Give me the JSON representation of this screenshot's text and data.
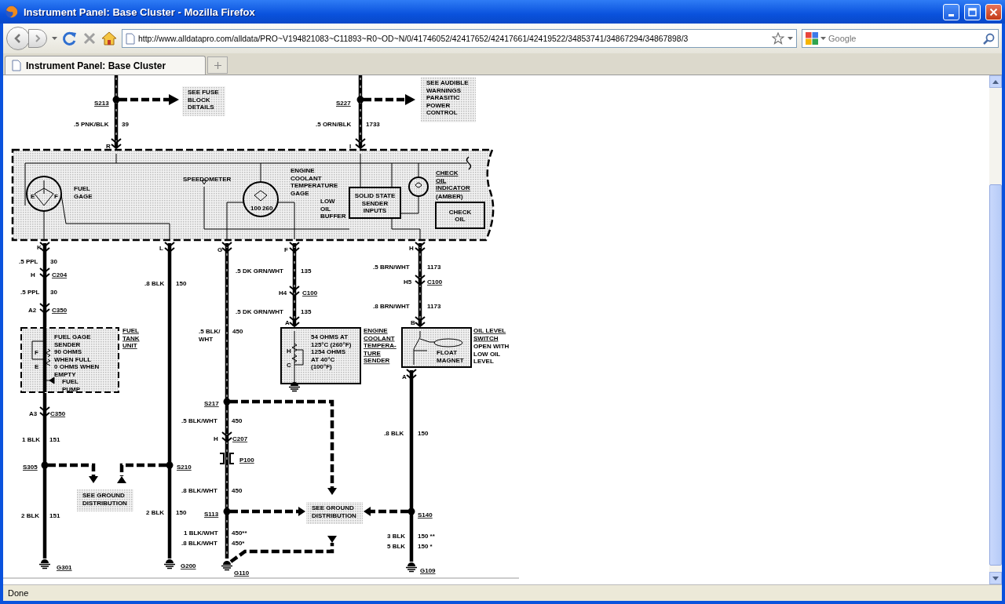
{
  "window": {
    "title": "Instrument Panel: Base Cluster - Mozilla Firefox"
  },
  "toolbar": {
    "url": "http://www.alldatapro.com/alldata/PRO~V194821083~C11893~R0~OD~N/0/41746052/42417652/42417661/42419522/34853741/34867294/34867898/3",
    "search": {
      "placeholder": "Google"
    }
  },
  "tabs": [
    {
      "label": "Instrument Panel: Base Cluster",
      "selected": true
    }
  ],
  "diagram": {
    "labels": [
      {
        "kind": "ref",
        "text": "S213"
      },
      {
        "kind": "callout",
        "lines": [
          "SEE FUSE",
          "BLOCK",
          "DETAILS"
        ]
      },
      {
        "kind": "ref",
        "text": "S227"
      },
      {
        "kind": "callout",
        "lines": [
          "SEE AUDIBLE",
          "WARNINGS",
          "PARASITIC",
          "POWER",
          "CONTROL"
        ]
      },
      {
        "kind": "wire",
        "text": ".5 PNK/BLK"
      },
      {
        "kind": "wire",
        "text": "39"
      },
      {
        "kind": "wire",
        "text": ".5 ORN/BLK"
      },
      {
        "kind": "wire",
        "text": "1733"
      },
      {
        "kind": "pin",
        "text": "R"
      },
      {
        "kind": "pin",
        "text": "I"
      },
      {
        "kind": "note",
        "lines": [
          "FUEL",
          "GAGE"
        ]
      },
      {
        "kind": "note",
        "text": "SPEEDOMETER"
      },
      {
        "kind": "note",
        "lines": [
          "ENGINE",
          "COOLANT",
          "TEMPERATURE",
          "GAGE"
        ]
      },
      {
        "kind": "note",
        "lines": [
          "LOW",
          "OIL",
          "BUFFER"
        ]
      },
      {
        "kind": "boxed",
        "lines": [
          "SOLID STATE",
          "SENDER",
          "INPUTS"
        ]
      },
      {
        "kind": "ref",
        "lines": [
          "CHECK",
          "OIL",
          "INDICATOR"
        ]
      },
      {
        "kind": "note",
        "text": "E"
      },
      {
        "kind": "note",
        "text": "F"
      },
      {
        "kind": "note",
        "text": "100"
      },
      {
        "kind": "note",
        "text": "260"
      },
      {
        "kind": "note",
        "text": "(AMBER)"
      },
      {
        "kind": "boxed",
        "lines": [
          "CHECK",
          "OIL"
        ]
      },
      {
        "kind": "pin",
        "text": "K"
      },
      {
        "kind": "pin",
        "text": "L"
      },
      {
        "kind": "pin",
        "text": "G"
      },
      {
        "kind": "pin",
        "text": "F"
      },
      {
        "kind": "pin",
        "text": "H"
      },
      {
        "kind": "wire",
        "text": ".5 PPL"
      },
      {
        "kind": "wire",
        "text": "30"
      },
      {
        "kind": "wire",
        "text": ".5 DK GRN/WHT"
      },
      {
        "kind": "wire",
        "text": "135"
      },
      {
        "kind": "wire",
        "text": ".5 BRN/WHT"
      },
      {
        "kind": "wire",
        "text": "1173"
      },
      {
        "kind": "pin",
        "text": "H"
      },
      {
        "kind": "ref",
        "text": "C204"
      },
      {
        "kind": "wire",
        "text": ".8 BLK"
      },
      {
        "kind": "wire",
        "text": "150"
      },
      {
        "kind": "pin",
        "text": "H5"
      },
      {
        "kind": "ref",
        "text": "C100"
      },
      {
        "kind": "wire",
        "text": ".5 PPL"
      },
      {
        "kind": "wire",
        "text": "30"
      },
      {
        "kind": "pin",
        "text": "H4"
      },
      {
        "kind": "ref",
        "text": "C100"
      },
      {
        "kind": "wire",
        "text": ".8 BRN/WHT"
      },
      {
        "kind": "wire",
        "text": "1173"
      },
      {
        "kind": "pin",
        "text": "A2"
      },
      {
        "kind": "ref",
        "text": "C350"
      },
      {
        "kind": "wire",
        "text": ".5 DK GRN/WHT"
      },
      {
        "kind": "wire",
        "text": "135"
      },
      {
        "kind": "pin",
        "text": "A"
      },
      {
        "kind": "pin",
        "text": "B"
      },
      {
        "kind": "wire",
        "lines": [
          ".5 BLK/",
          "WHT"
        ]
      },
      {
        "kind": "wire",
        "text": "450"
      },
      {
        "kind": "note",
        "text": "F"
      },
      {
        "kind": "note",
        "text": "E"
      },
      {
        "kind": "note",
        "lines": [
          "FUEL GAGE",
          "SENDER",
          "90 OHMS",
          "WHEN FULL",
          "0 OHMS WHEN",
          "EMPTY"
        ]
      },
      {
        "kind": "note",
        "lines": [
          "FUEL",
          "PUMP"
        ]
      },
      {
        "kind": "ref",
        "lines": [
          "FUEL",
          "TANK",
          "UNIT"
        ]
      },
      {
        "kind": "note",
        "text": "H"
      },
      {
        "kind": "note",
        "text": "C"
      },
      {
        "kind": "note",
        "lines": [
          "54 OHMS AT",
          "125°C (260°F)",
          "1254 OHMS",
          "AT 40°C",
          "(100°F)"
        ]
      },
      {
        "kind": "ref",
        "lines": [
          "ENGINE",
          "COOLANT",
          "TEMPERA-",
          "TURE",
          "SENDER"
        ]
      },
      {
        "kind": "note",
        "lines": [
          "FLOAT",
          "MAGNET"
        ]
      },
      {
        "kind": "ref",
        "lines": [
          "OIL LEVEL",
          "SWITCH"
        ]
      },
      {
        "kind": "note",
        "lines": [
          "OPEN WITH",
          "LOW OIL",
          "LEVEL"
        ]
      },
      {
        "kind": "pin",
        "text": "A"
      },
      {
        "kind": "ref",
        "text": "S217"
      },
      {
        "kind": "pin",
        "text": "A3"
      },
      {
        "kind": "ref",
        "text": "C350"
      },
      {
        "kind": "wire",
        "text": ".5 BLK/WHT"
      },
      {
        "kind": "wire",
        "text": "450"
      },
      {
        "kind": "wire",
        "text": ".8 BLK"
      },
      {
        "kind": "wire",
        "text": "150"
      },
      {
        "kind": "wire",
        "text": "1 BLK"
      },
      {
        "kind": "wire",
        "text": "151"
      },
      {
        "kind": "pin",
        "text": "H"
      },
      {
        "kind": "ref",
        "text": "C207"
      },
      {
        "kind": "ref",
        "text": "P100"
      },
      {
        "kind": "ref",
        "text": "S305"
      },
      {
        "kind": "ref",
        "text": "S210"
      },
      {
        "kind": "callout",
        "lines": [
          "SEE GROUND",
          "DISTRIBUTION"
        ]
      },
      {
        "kind": "wire",
        "text": ".8 BLK/WHT"
      },
      {
        "kind": "wire",
        "text": "450"
      },
      {
        "kind": "wire",
        "text": "2 BLK"
      },
      {
        "kind": "wire",
        "text": "151"
      },
      {
        "kind": "wire",
        "text": "2 BLK"
      },
      {
        "kind": "wire",
        "text": "150"
      },
      {
        "kind": "ref",
        "text": "S113"
      },
      {
        "kind": "callout",
        "lines": [
          "SEE GROUND",
          "DISTRIBUTION"
        ]
      },
      {
        "kind": "ref",
        "text": "S140"
      },
      {
        "kind": "wire",
        "text": "1 BLK/WHT"
      },
      {
        "kind": "wire",
        "text": "450**"
      },
      {
        "kind": "wire",
        "text": "3 BLK"
      },
      {
        "kind": "wire",
        "text": "150 **"
      },
      {
        "kind": "wire",
        "text": ".8 BLK/WHT"
      },
      {
        "kind": "wire",
        "text": "450*"
      },
      {
        "kind": "wire",
        "text": "5 BLK"
      },
      {
        "kind": "wire",
        "text": "150 *"
      },
      {
        "kind": "ref",
        "text": "G301"
      },
      {
        "kind": "ref",
        "text": "G200"
      },
      {
        "kind": "ref",
        "text": "G110"
      },
      {
        "kind": "ref",
        "text": "G109"
      }
    ]
  },
  "status_bar": {
    "text": "Done"
  }
}
